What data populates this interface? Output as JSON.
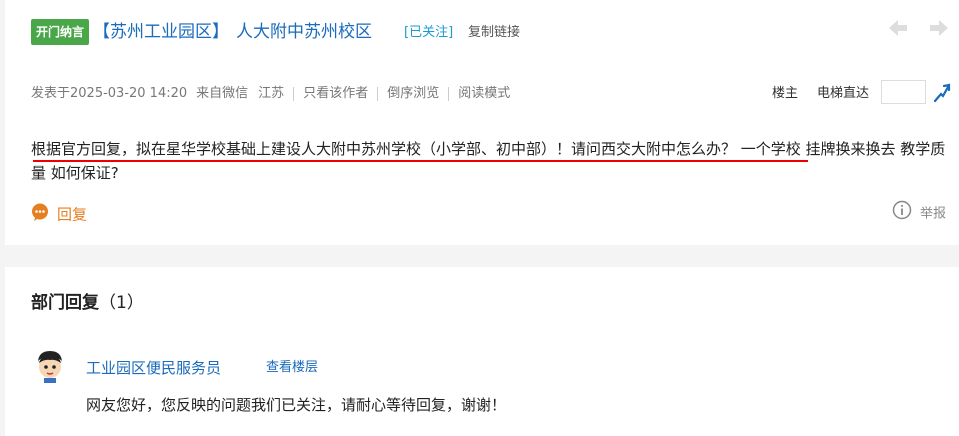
{
  "thread": {
    "badge": "开门纳言",
    "topic": "【苏州工业园区】",
    "title": "人大附中苏州校区",
    "followed": "[已关注]",
    "copy_link": "复制链接"
  },
  "meta": {
    "posted": "发表于2025-03-20 14:20",
    "source": "来自微信",
    "location": "江苏",
    "only_author": "只看该作者",
    "reverse": "倒序浏览",
    "reading_mode": "阅读模式"
  },
  "floor_nav": {
    "owner": "楼主",
    "jump_label": "电梯直达",
    "jump_value": ""
  },
  "post": {
    "content": "根据官方回复，拟在星华学校基础上建设人大附中苏州学校（小学部、初中部）！请问西交大附中怎么办？ 一个学校 挂牌换来换去 教学质量 如何保证?",
    "reply_label": "回复",
    "report_label": "举报"
  },
  "replies": {
    "section_label": "部门回复",
    "count": "（1）",
    "items": [
      {
        "author": "工业园区便民服务员",
        "view_floor": "查看楼层",
        "text": "网友您好，您反映的问题我们已关注，请耐心等待回复，谢谢！"
      }
    ]
  },
  "colors": {
    "badge_bg": "#4aa749",
    "link": "#1a6bbd",
    "reply_accent": "#e67e22",
    "underline": "#e00000"
  },
  "icons": {
    "prev": "arrow-left-icon",
    "next": "arrow-right-icon",
    "jump": "jump-icon",
    "reply": "chat-bubble-icon",
    "report": "info-circle-icon",
    "avatar": "cartoon-avatar-icon"
  }
}
